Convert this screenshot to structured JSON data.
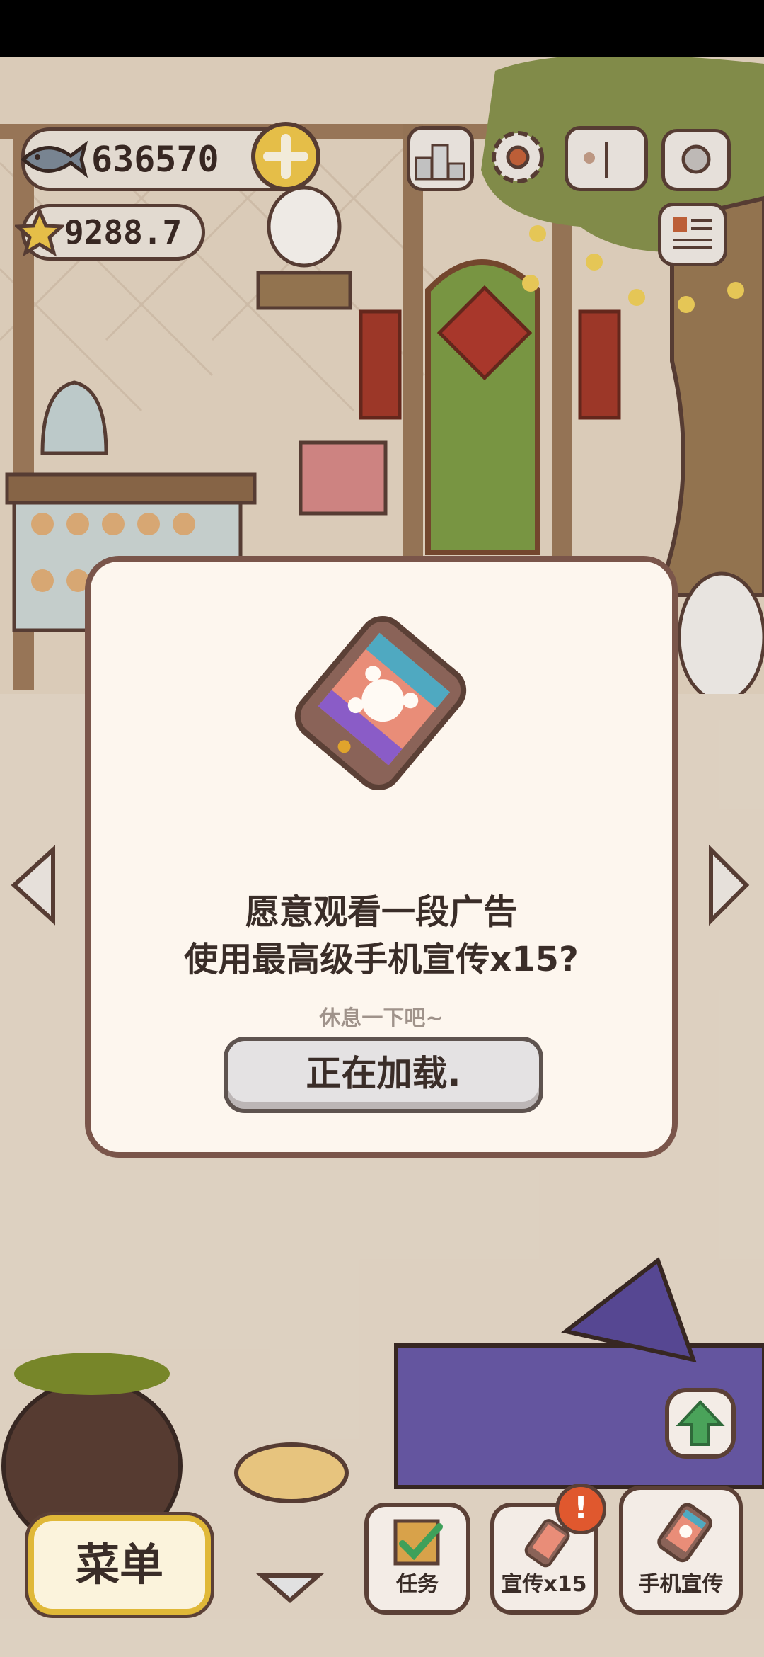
{
  "hud": {
    "fish_count": "636570",
    "star_count": "9288.7"
  },
  "icons": {
    "fish": "fish-icon",
    "star": "star-icon",
    "plus": "plus-icon",
    "ranking": "ranking-icon",
    "settings": "gear-icon",
    "book": "book-icon",
    "camera": "camera-icon",
    "news": "newspaper-icon"
  },
  "dialog": {
    "line1": "愿意观看一段广告",
    "line2": "使用最高级手机宣传x15?",
    "subtitle": "休息一下吧~",
    "button_label": "正在加载."
  },
  "bottom": {
    "menu_label": "菜单",
    "task_label": "任务",
    "promo15_label": "宣传x15",
    "phone_promo_label": "手机宣传"
  },
  "colors": {
    "dialog_bg": "#fdf6ee",
    "dialog_border": "#7a554a",
    "alert_badge": "#e0582e",
    "gold": "#f2c94c"
  }
}
